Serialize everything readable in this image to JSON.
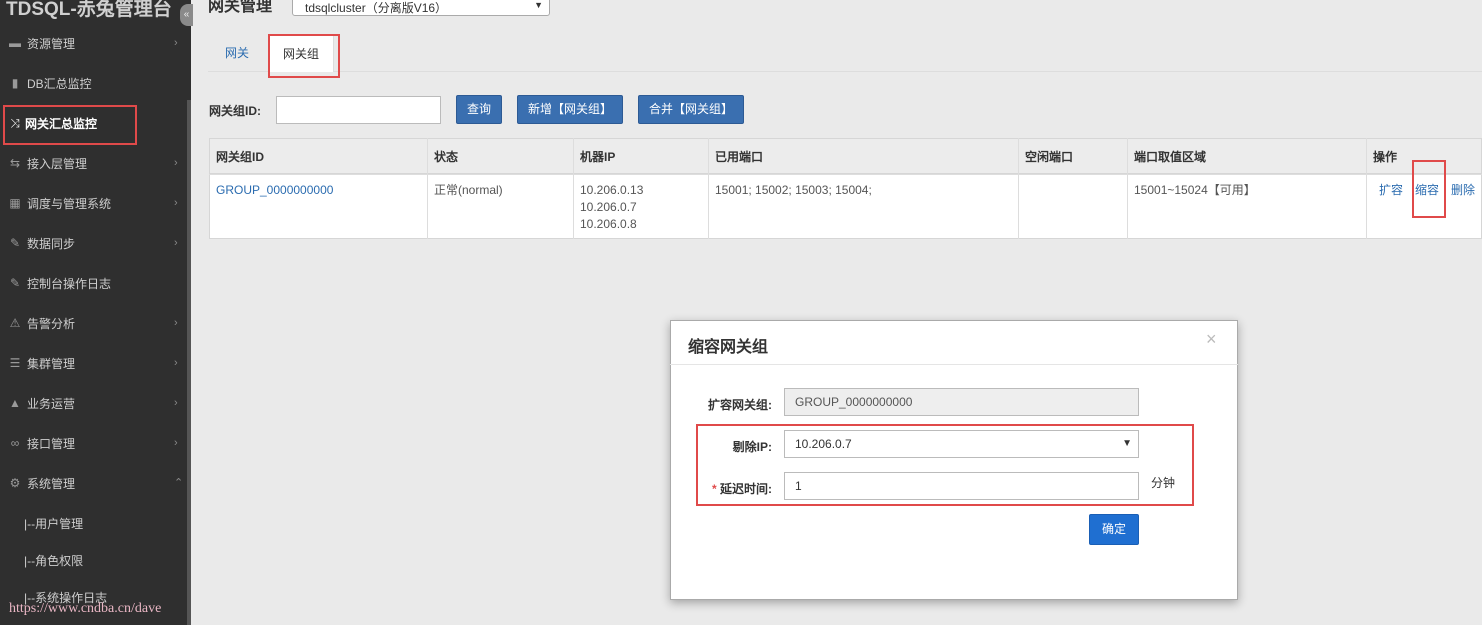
{
  "app": {
    "title": "TDSQL-赤兔管理台",
    "collapse_icon": "«"
  },
  "sidebar": {
    "items": [
      {
        "label": "资源管理",
        "icon": "server-icon",
        "glyph": "▬",
        "chevron": "›"
      },
      {
        "label": "DB汇总监控",
        "icon": "database-icon",
        "glyph": "▮",
        "chevron": ""
      },
      {
        "label": "网关汇总监控",
        "icon": "shuffle-icon",
        "glyph": "⤨",
        "chevron": ""
      },
      {
        "label": "接入层管理",
        "icon": "retweet-icon",
        "glyph": "⇆",
        "chevron": "›"
      },
      {
        "label": "调度与管理系统",
        "icon": "grid-icon",
        "glyph": "▦",
        "chevron": "›"
      },
      {
        "label": "数据同步",
        "icon": "wrench-icon",
        "glyph": "✎",
        "chevron": "›"
      },
      {
        "label": "控制台操作日志",
        "icon": "wrench-icon",
        "glyph": "✎",
        "chevron": ""
      },
      {
        "label": "告警分析",
        "icon": "warning-icon",
        "glyph": "⚠",
        "chevron": "›"
      },
      {
        "label": "集群管理",
        "icon": "list-icon",
        "glyph": "☰",
        "chevron": "›"
      },
      {
        "label": "业务运营",
        "icon": "road-icon",
        "glyph": "▲",
        "chevron": "›"
      },
      {
        "label": "接口管理",
        "icon": "link-icon",
        "glyph": "∞",
        "chevron": "›"
      },
      {
        "label": "系统管理",
        "icon": "gear-icon",
        "glyph": "⚙",
        "chevron": "⌃"
      }
    ],
    "sub_items": [
      "|--用户管理",
      "|--角色权限",
      "|--系统操作日志"
    ]
  },
  "header": {
    "page_title": "网关管理",
    "cluster_select": "tdsqlcluster（分离版V16）"
  },
  "tabs": [
    {
      "label": "网关"
    },
    {
      "label": "网关组"
    }
  ],
  "filter": {
    "group_id_label": "网关组ID:",
    "group_id_value": "",
    "query_button": "查询",
    "add_button": "新增【网关组】",
    "merge_button": "合并【网关组】"
  },
  "table": {
    "columns": [
      "网关组ID",
      "状态",
      "机器IP",
      "已用端口",
      "空闲端口",
      "端口取值区域",
      "操作"
    ],
    "rows": [
      {
        "group_id": "GROUP_0000000000",
        "status": "正常(normal)",
        "ips": [
          "10.206.0.13",
          "10.206.0.7",
          "10.206.0.8"
        ],
        "used_ports": "15001; 15002; 15003; 15004;",
        "free_ports": "",
        "port_range": "15001~15024【可用】",
        "actions": [
          "扩容",
          "缩容",
          "删除"
        ]
      }
    ]
  },
  "modal": {
    "title": "缩容网关组",
    "close": "×",
    "group_label": "扩容网关组:",
    "group_value": "GROUP_0000000000",
    "ip_label": "剔除IP:",
    "ip_value": "10.206.0.7",
    "delay_required": "*",
    "delay_label": "延迟时间:",
    "delay_value": "1",
    "delay_unit": "分钟",
    "confirm_button": "确定"
  },
  "watermark": "https://www.cndba.cn/dave",
  "colors": {
    "sidebar_bg": "#2f2f2f",
    "primary_button": "#3a6fb0",
    "confirm_button": "#1f6fd1",
    "link": "#2b6cb0",
    "highlight_box": "#e04a4a"
  }
}
